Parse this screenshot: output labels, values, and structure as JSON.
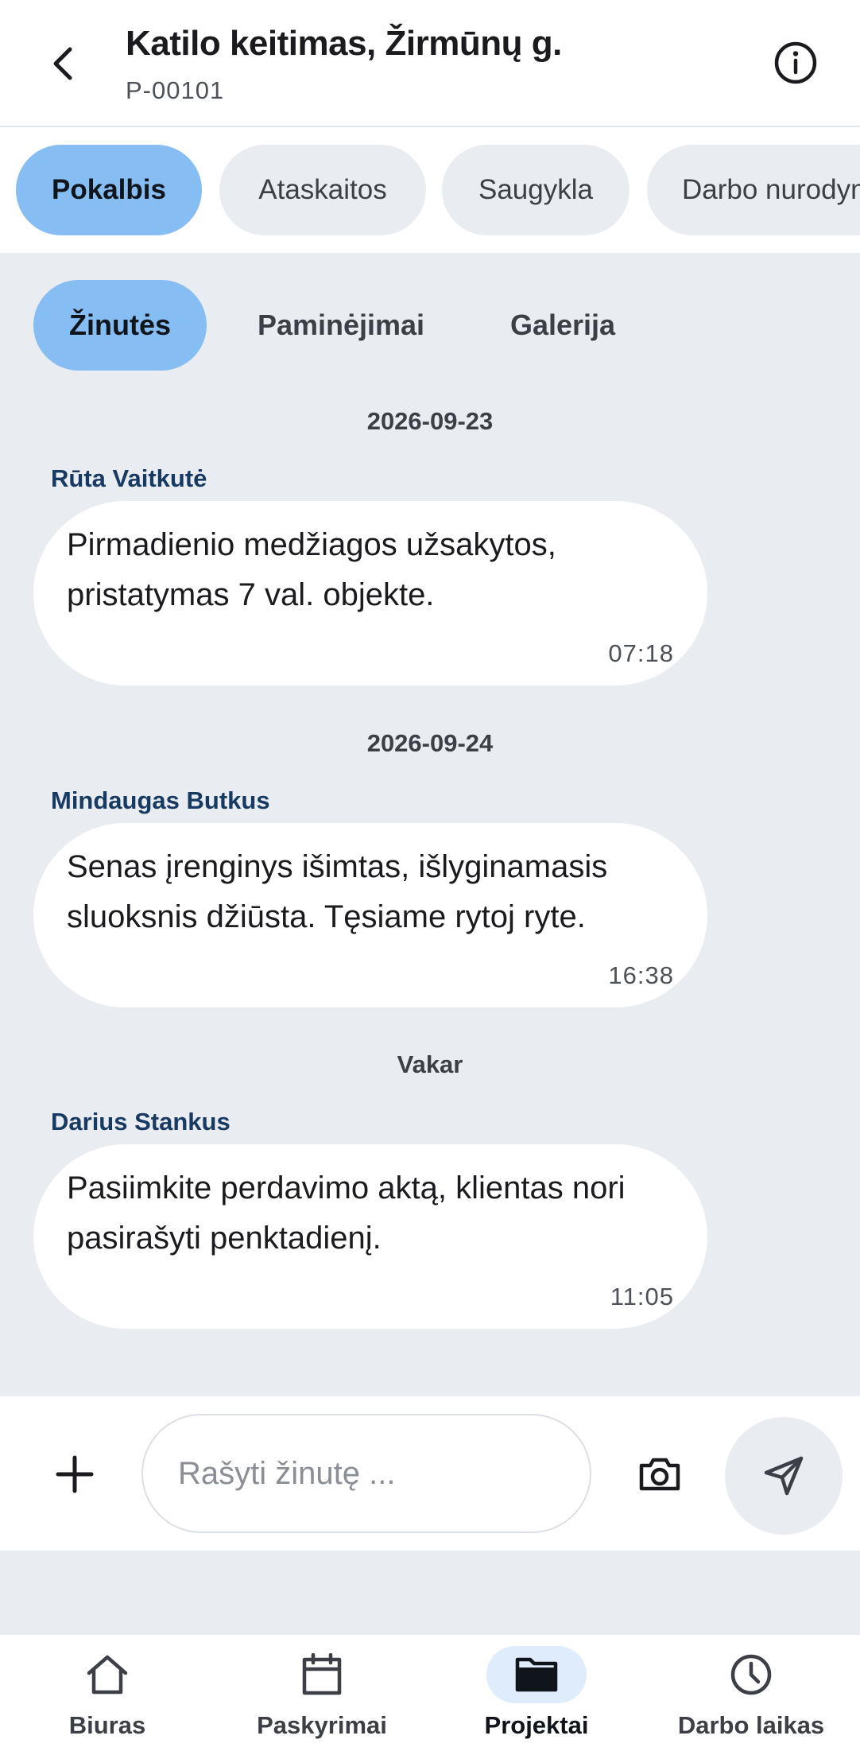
{
  "header": {
    "title": "Katilo keitimas, Žirmūnų g.",
    "project_code": "P-00101"
  },
  "top_tabs": [
    {
      "label": "Pokalbis",
      "active": true
    },
    {
      "label": "Ataskaitos",
      "active": false
    },
    {
      "label": "Saugykla",
      "active": false
    },
    {
      "label": "Darbo nurodymai",
      "active": false
    }
  ],
  "sub_tabs": [
    {
      "label": "Žinutės",
      "active": true
    },
    {
      "label": "Paminėjimai",
      "active": false
    },
    {
      "label": "Galerija",
      "active": false
    }
  ],
  "messages": [
    {
      "date": "2026-09-23",
      "sender": "Rūta Vaitkutė",
      "text": "Pirmadienio medžiagos užsakytos, pristatymas 7 val. objekte.",
      "time": "07:18"
    },
    {
      "date": "2026-09-24",
      "sender": "Mindaugas Butkus",
      "text": "Senas įrenginys išimtas, išlyginamasis sluoksnis džiūsta. Tęsiame rytoj ryte.",
      "time": "16:38"
    },
    {
      "date": "Vakar",
      "sender": "Darius Stankus",
      "text": "Pasiimkite perdavimo aktą, klientas nori pasirašyti penktadienį.",
      "time": "11:05"
    }
  ],
  "composer": {
    "placeholder": "Rašyti žinutę ...",
    "value": ""
  },
  "bottom_nav": [
    {
      "label": "Biuras",
      "icon": "home-icon",
      "active": false
    },
    {
      "label": "Paskyrimai",
      "icon": "calendar-icon",
      "active": false
    },
    {
      "label": "Projektai",
      "icon": "folder-icon",
      "active": true
    },
    {
      "label": "Darbo laikas",
      "icon": "clock-icon",
      "active": false
    }
  ],
  "colors": {
    "accent": "#86bdf2",
    "accent_light": "#deecfb",
    "background": "#e9ecf0",
    "sender_name": "#173a63"
  }
}
